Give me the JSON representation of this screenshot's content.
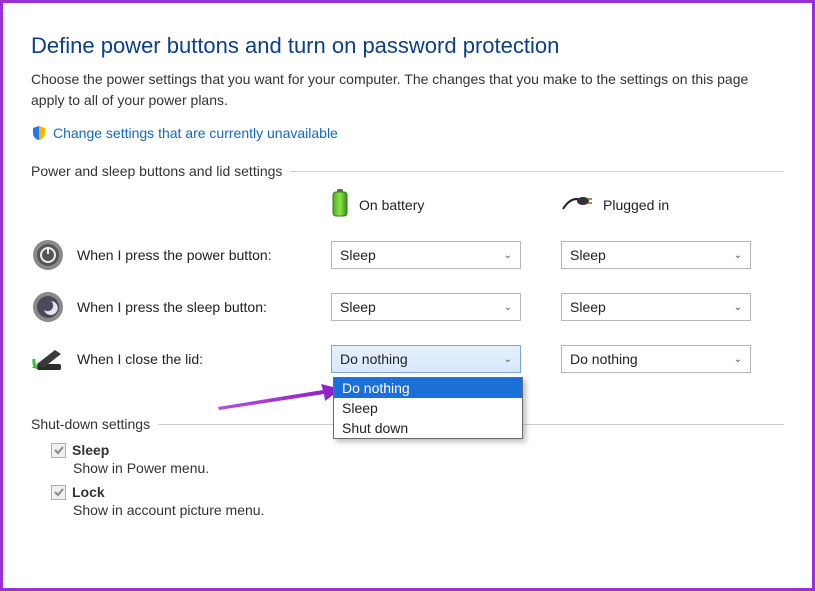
{
  "title": "Define power buttons and turn on password protection",
  "subtext": "Choose the power settings that you want for your computer. The changes that you make to the settings on this page apply to all of your power plans.",
  "change_link": "Change settings that are currently unavailable",
  "section_buttons": "Power and sleep buttons and lid settings",
  "columns": {
    "battery": "On battery",
    "plugged": "Plugged in"
  },
  "rows": {
    "power": {
      "label": "When I press the power button:",
      "battery": "Sleep",
      "plugged": "Sleep"
    },
    "sleep": {
      "label": "When I press the sleep button:",
      "battery": "Sleep",
      "plugged": "Sleep"
    },
    "lid": {
      "label": "When I close the lid:",
      "battery": "Do nothing",
      "plugged": "Do nothing"
    }
  },
  "lid_dropdown": {
    "options": [
      "Do nothing",
      "Sleep",
      "Shut down"
    ],
    "selected": "Do nothing"
  },
  "section_shutdown": "Shut-down settings",
  "shutdown": {
    "sleep": {
      "label": "Sleep",
      "sub": "Show in Power menu."
    },
    "lock": {
      "label": "Lock",
      "sub": "Show in account picture menu."
    }
  }
}
